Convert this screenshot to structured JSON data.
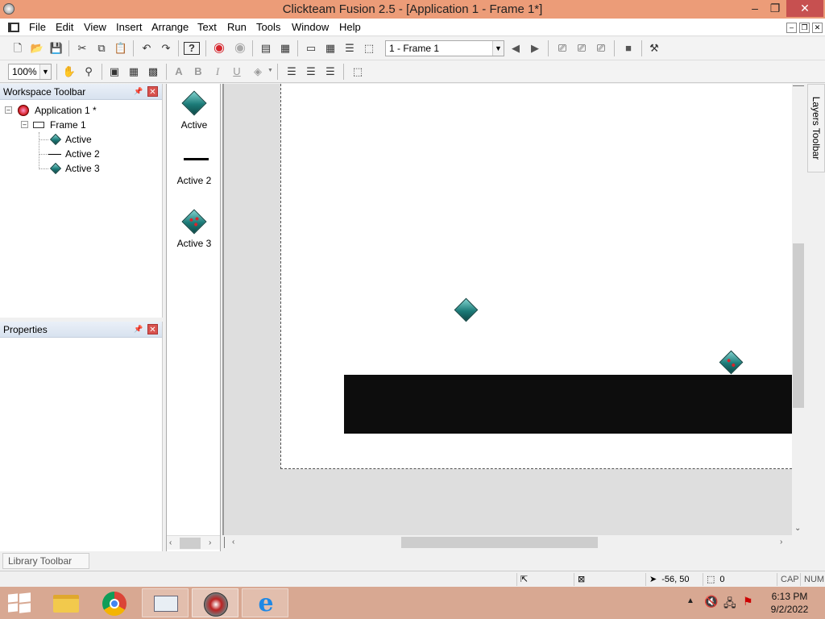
{
  "window": {
    "title": "Clickteam Fusion 2.5 - [Application 1 - Frame 1*]",
    "minimize": "–",
    "restore": "❐",
    "close": "✕"
  },
  "menu": [
    "File",
    "Edit",
    "View",
    "Insert",
    "Arrange",
    "Text",
    "Run",
    "Tools",
    "Window",
    "Help"
  ],
  "toolbar": {
    "frame_selector": "1 - Frame 1",
    "zoom": "100%"
  },
  "workspace": {
    "title": "Workspace Toolbar",
    "tree": {
      "application": "Application 1 *",
      "frame": "Frame 1",
      "objects": [
        "Active",
        "Active 2",
        "Active 3"
      ]
    }
  },
  "properties": {
    "title": "Properties"
  },
  "object_list": [
    "Active",
    "Active 2",
    "Active 3"
  ],
  "layers_toolbar": "Layers Toolbar",
  "library_toolbar": "Library Toolbar",
  "status": {
    "coords": "-56, 50",
    "count": "0",
    "caps": "CAP",
    "num": "NUM"
  },
  "taskbar": {
    "time": "6:13 PM",
    "date": "9/2/2022"
  },
  "colors": {
    "titlebar": "#ec9c78",
    "taskbar": "#d8a892",
    "accent_teal": "#1c7b78",
    "red": "#d6252d"
  }
}
